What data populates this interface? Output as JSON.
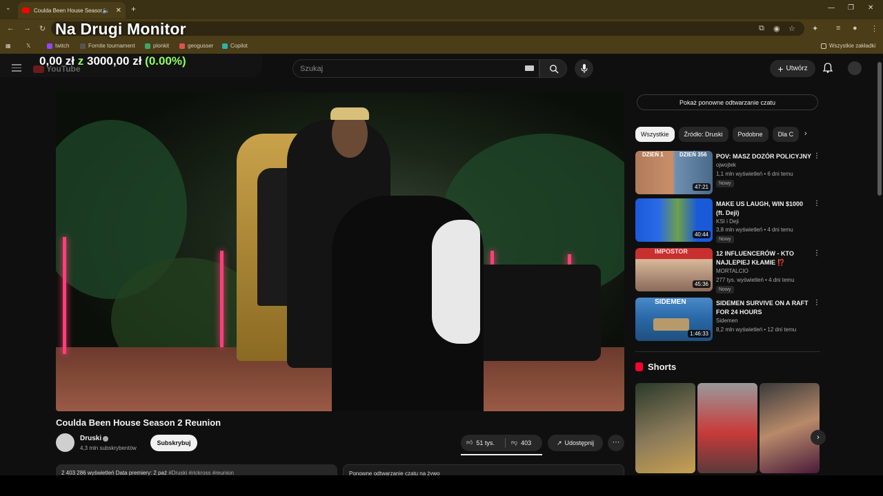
{
  "browser": {
    "tab_title": "Coulda Been House Season",
    "bookmarks": [
      "twitch",
      "Fornite tournament",
      "plonkit",
      "geogusser",
      "Copilot"
    ],
    "all_bookmarks": "Wszystkie zakładki"
  },
  "overlay": {
    "title": "Na Drugi Monitor",
    "money_current": "0,00 zł",
    "money_of": "z",
    "money_target": "3000,00 zł",
    "money_pct": "(0.00%)"
  },
  "youtube": {
    "logo": "YouTube",
    "search_placeholder": "Szukaj",
    "create_label": "Utwórz"
  },
  "video": {
    "title": "Coulda Been House Season 2 Reunion",
    "channel": "Druski",
    "subscribers": "4,3 mln subskrybentów",
    "subscribe_label": "Subskrybuj",
    "likes": "51 tys.",
    "dislikes": "403",
    "share_label": "Udostępnij",
    "more": "···",
    "description_preview": "2 403 286 wyświetleń  Data premiery: 2 paź",
    "description_tags": "#Druski #rickross #reunion",
    "chat_replay_preview": "Ponowne odtwarzanie czatu na żywo"
  },
  "sidebar": {
    "chat_replay_label": "Pokaż ponowne odtwarzanie czatu",
    "chips": [
      "Wszystkie",
      "Źródło: Druski",
      "Podobne",
      "Dla C"
    ],
    "recommendations": [
      {
        "title": "POV: MASZ DOZÓR POLICYJNY",
        "channel": "ojwojtek",
        "meta": "1,1 mln wyświetleń • 6 dni temu",
        "badge": "Nowy",
        "duration": "47:21",
        "thumb_top": "DZIEŃ 1",
        "thumb_top2": "DZIEŃ 356"
      },
      {
        "title": "MAKE US LAUGH, WIN $1000 (ft. Deji)",
        "channel": "KSI i Deji",
        "meta": "3,8 mln wyświetleń • 4 dni temu",
        "badge": "Nowy",
        "duration": "40:44"
      },
      {
        "title": "12 INFLUENCERÓW - KTO NAJLEPIEJ KŁAMIE ⁉️",
        "channel": "MORTALCIO",
        "meta": "277 tys. wyświetleń • 4 dni temu",
        "badge": "Nowy",
        "duration": "45:36",
        "thumb_top": "IMPOSTOR"
      },
      {
        "title": "SIDEMEN SURVIVE ON A RAFT FOR 24 HOURS",
        "channel": "Sidemen",
        "meta": "8,2 mln wyświetleń • 12 dni temu",
        "badge": "",
        "duration": "1:46:33",
        "thumb_top": "SIDEMEN"
      }
    ],
    "shorts_label": "Shorts"
  },
  "colors": {
    "accent_red": "#ff0000",
    "overlay_green": "#8fff5a",
    "bg": "#0f0f0f"
  }
}
